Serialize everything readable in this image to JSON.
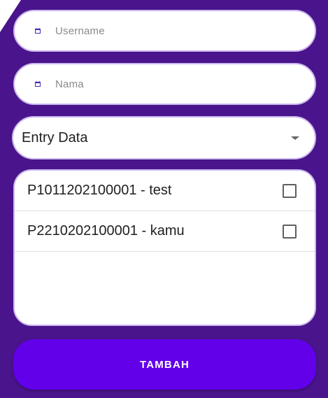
{
  "form": {
    "username_placeholder": "Username",
    "nama_placeholder": "Nama",
    "field_icon": "calendar-icon"
  },
  "dropdown": {
    "selected": "Entry Data",
    "icon": "arrow-drop-down-icon"
  },
  "list": {
    "items": [
      {
        "label": "P1011202100001 - test",
        "checked": false
      },
      {
        "label": "P2210202100001 - kamu",
        "checked": false
      }
    ]
  },
  "button": {
    "label": "TAMBAH"
  },
  "colors": {
    "background": "#4a148c",
    "accent": "#6200ea",
    "icon": "#4b2ab4"
  }
}
